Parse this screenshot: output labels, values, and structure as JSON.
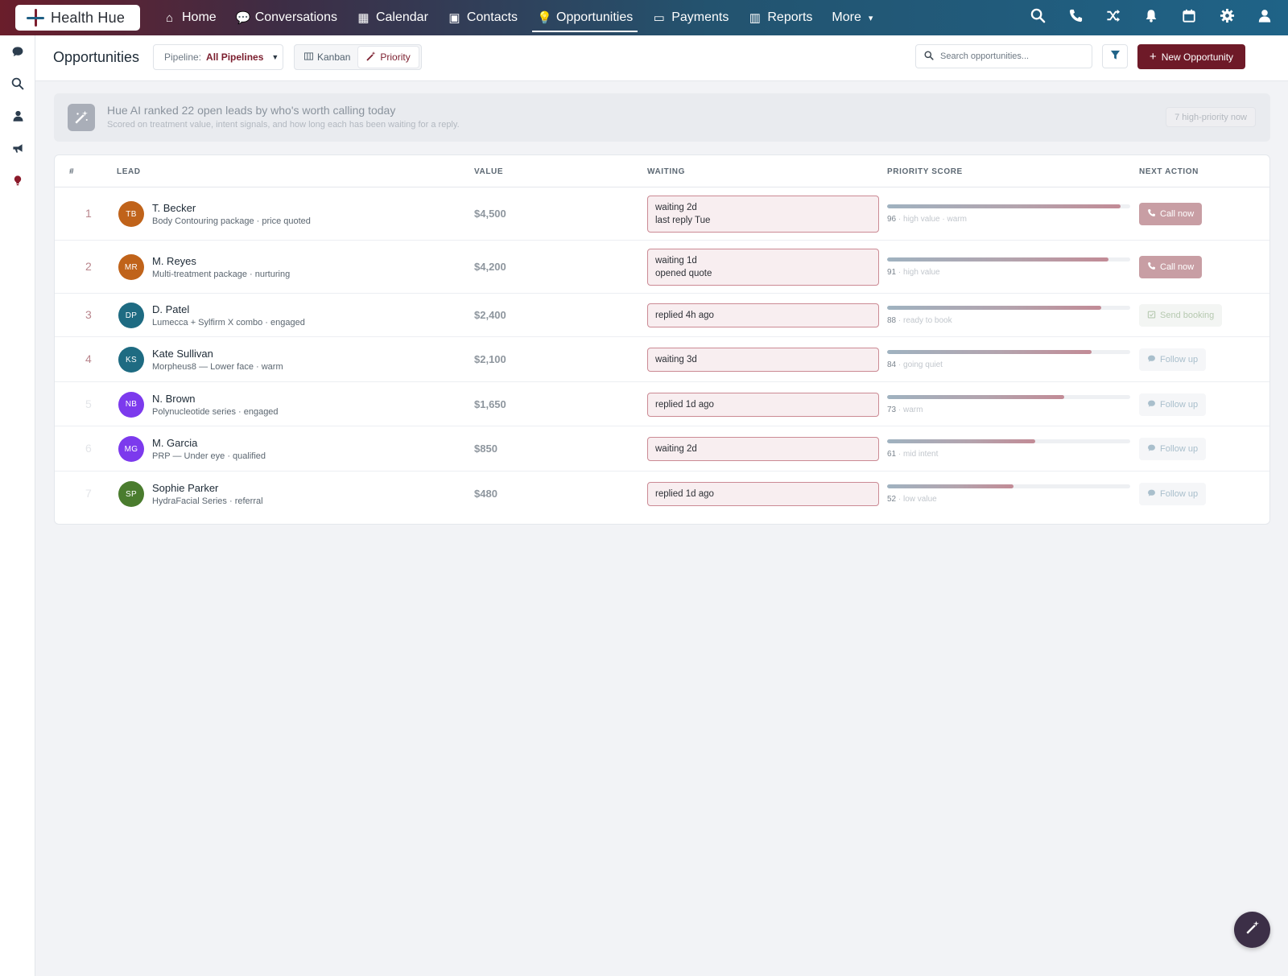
{
  "app": {
    "name": "Health Hue"
  },
  "nav": {
    "items": [
      {
        "label": "Home",
        "icon": "home-icon",
        "glyph": "⌂"
      },
      {
        "label": "Conversations",
        "icon": "chat-icon",
        "glyph": "💬"
      },
      {
        "label": "Calendar",
        "icon": "calendar-icon",
        "glyph": "▦"
      },
      {
        "label": "Contacts",
        "icon": "contact-card-icon",
        "glyph": "▣"
      },
      {
        "label": "Opportunities",
        "icon": "lightbulb-icon",
        "glyph": "💡",
        "active": true
      },
      {
        "label": "Payments",
        "icon": "credit-card-icon",
        "glyph": "▭"
      },
      {
        "label": "Reports",
        "icon": "bar-chart-icon",
        "glyph": "▥"
      },
      {
        "label": "More",
        "icon": "chevron-down-icon",
        "glyph": "▾"
      }
    ],
    "right_icons": [
      "search-icon",
      "phone-icon",
      "shuffle-icon",
      "bell-icon",
      "calendar-icon",
      "gear-icon",
      "user-icon"
    ]
  },
  "rail": {
    "icons": [
      "chat-icon",
      "search-icon",
      "user-icon",
      "megaphone-icon",
      "lightbulb-icon"
    ]
  },
  "header": {
    "title": "Opportunities",
    "pipeline_label": "Pipeline:",
    "pipeline_value": "All Pipelines",
    "view_kanban": "Kanban",
    "view_priority": "Priority",
    "search_placeholder": "Search opportunities...",
    "new_button": "New Opportunity"
  },
  "ai_banner": {
    "title": "Hue AI ranked 22 open leads by who's worth calling today",
    "subtitle": "Scored on treatment value, intent signals, and how long each has been waiting for a reply.",
    "badge": "7 high-priority now"
  },
  "table": {
    "columns": [
      "#",
      "LEAD",
      "VALUE",
      "WAITING",
      "PRIORITY SCORE",
      "NEXT ACTION"
    ],
    "rows": [
      {
        "rank": "1",
        "initials": "TB",
        "avatar_color": "#c0631a",
        "name": "T. Becker",
        "sub": "Body Contouring package · price quoted",
        "value": "$4,500",
        "waiting": "waiting 2d",
        "waiting2": "last reply Tue",
        "score": 96,
        "score_num": "96",
        "score_note": " · high value · warm",
        "action": "Call now",
        "action_type": "primary"
      },
      {
        "rank": "2",
        "initials": "MR",
        "avatar_color": "#c0631a",
        "name": "M. Reyes",
        "sub": "Multi-treatment package · nurturing",
        "value": "$4,200",
        "waiting": "waiting 1d",
        "waiting2": "opened quote",
        "score": 91,
        "score_num": "91",
        "score_note": " · high value",
        "action": "Call now",
        "action_type": "primary"
      },
      {
        "rank": "3",
        "initials": "DP",
        "avatar_color": "#1e6b82",
        "name": "D. Patel",
        "sub": "Lumecca + Sylfirm X combo · engaged",
        "value": "$2,400",
        "waiting": "replied 4h ago",
        "waiting2": "",
        "score": 88,
        "score_num": "88",
        "score_note": " · ready to book",
        "action": "Send booking",
        "action_type": "booking"
      },
      {
        "rank": "4",
        "initials": "KS",
        "avatar_color": "#1e6b82",
        "name": "Kate Sullivan",
        "sub": "Morpheus8 — Lower face · warm",
        "value": "$2,100",
        "waiting": "waiting 3d",
        "waiting2": "",
        "score": 84,
        "score_num": "84",
        "score_note": " · going quiet",
        "action": "Follow up",
        "action_type": "ghost"
      },
      {
        "rank": "5",
        "initials": "NB",
        "avatar_color": "#7c3aed",
        "name": "N. Brown",
        "sub": "Polynucleotide series · engaged",
        "value": "$1,650",
        "waiting": "replied 1d ago",
        "waiting2": "",
        "score": 73,
        "score_num": "73",
        "score_note": " · warm",
        "action": "Follow up",
        "action_type": "ghost"
      },
      {
        "rank": "6",
        "initials": "MG",
        "avatar_color": "#7c3aed",
        "name": "M. Garcia",
        "sub": "PRP — Under eye · qualified",
        "value": "$850",
        "waiting": "waiting 2d",
        "waiting2": "",
        "score": 61,
        "score_num": "61",
        "score_note": " · mid intent",
        "action": "Follow up",
        "action_type": "ghost"
      },
      {
        "rank": "7",
        "initials": "SP",
        "avatar_color": "#4a7c2e",
        "name": "Sophie Parker",
        "sub": "HydraFacial Series · referral",
        "value": "$480",
        "waiting": "replied 1d ago",
        "waiting2": "",
        "score": 52,
        "score_num": "52",
        "score_note": " · low value",
        "action": "Follow up",
        "action_type": "ghost"
      }
    ]
  },
  "colors": {
    "brand": "#6e1a28",
    "accent": "#1f6387",
    "rank_strong": "#b9858c",
    "rank_mid": "#c9a9ae",
    "rank_faint": "#e3e5e9"
  }
}
